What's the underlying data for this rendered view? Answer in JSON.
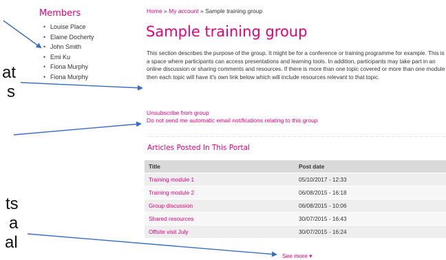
{
  "slide_fragments": [
    "at",
    "s",
    "ts",
    "a",
    "al"
  ],
  "members": {
    "title": "Members",
    "items": [
      "Louise Place",
      "Elaine Docherty",
      "John Smith",
      "Emi Ku",
      "Fiona Murphy",
      "Fiona Murphy"
    ]
  },
  "breadcrumb": {
    "home": "Home",
    "sep1": " » ",
    "account": "My account",
    "sep2": " » ",
    "current": "Sample training group"
  },
  "page_title": "Sample training group",
  "description": "This section describes the purpose of the group. It might be for a conference or training programme for example. This is a space where participants can access presentations and learning tools. In addition, participants may take part in an online discussion or sharing comments and resources. If there is more than one topic covered or more than one module then each topic will have it's own link below which will include resources relevant to that topic.",
  "actions": {
    "unsubscribe": "Unsubscribe from group",
    "no_notifications": "Do not send me automatic email notifications relating to this group"
  },
  "articles": {
    "heading": "Articles Posted In This Portal",
    "columns": [
      "Title",
      "Post date"
    ],
    "rows": [
      {
        "title": "Training module 1",
        "date": "05/10/2017 - 12:33"
      },
      {
        "title": "Training module 2",
        "date": "06/08/2015 - 16:18"
      },
      {
        "title": "Group discussion",
        "date": "06/08/2015 - 10:06"
      },
      {
        "title": "Shared resources",
        "date": "30/07/2015 - 16:43"
      },
      {
        "title": "Offsite visit July",
        "date": "30/07/2015 - 16:24"
      }
    ],
    "see_more": "See more ▾"
  },
  "colors": {
    "accent": "#e6007e",
    "arrow": "#3a6cc4",
    "header_bg": "#d9d9d9"
  },
  "icons": {
    "bullet": "•",
    "arrow": "arrow-icon"
  }
}
